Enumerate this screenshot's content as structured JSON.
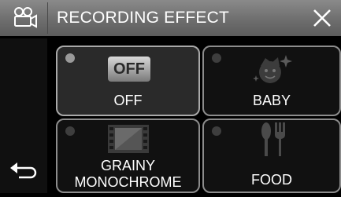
{
  "header": {
    "title": "RECORDING EFFECT",
    "mode_icon": "video-camera-icon",
    "close_icon": "close-icon"
  },
  "navigation": {
    "back_icon": "return-arrow-icon"
  },
  "effects": [
    {
      "label": "OFF",
      "icon": "off-icon",
      "icon_text": "OFF",
      "selected": true
    },
    {
      "label": "BABY",
      "icon": "baby-sparkle-icon",
      "selected": false
    },
    {
      "label_line1": "GRAINY",
      "label_line2": "MONOCHROME",
      "icon": "film-strip-icon",
      "selected": false
    },
    {
      "label": "FOOD",
      "icon": "fork-knife-icon",
      "selected": false
    }
  ],
  "colors": {
    "titlebar": "#767676",
    "tile_border": "#8c8c8c",
    "selected_background": "#2a2a2a"
  }
}
